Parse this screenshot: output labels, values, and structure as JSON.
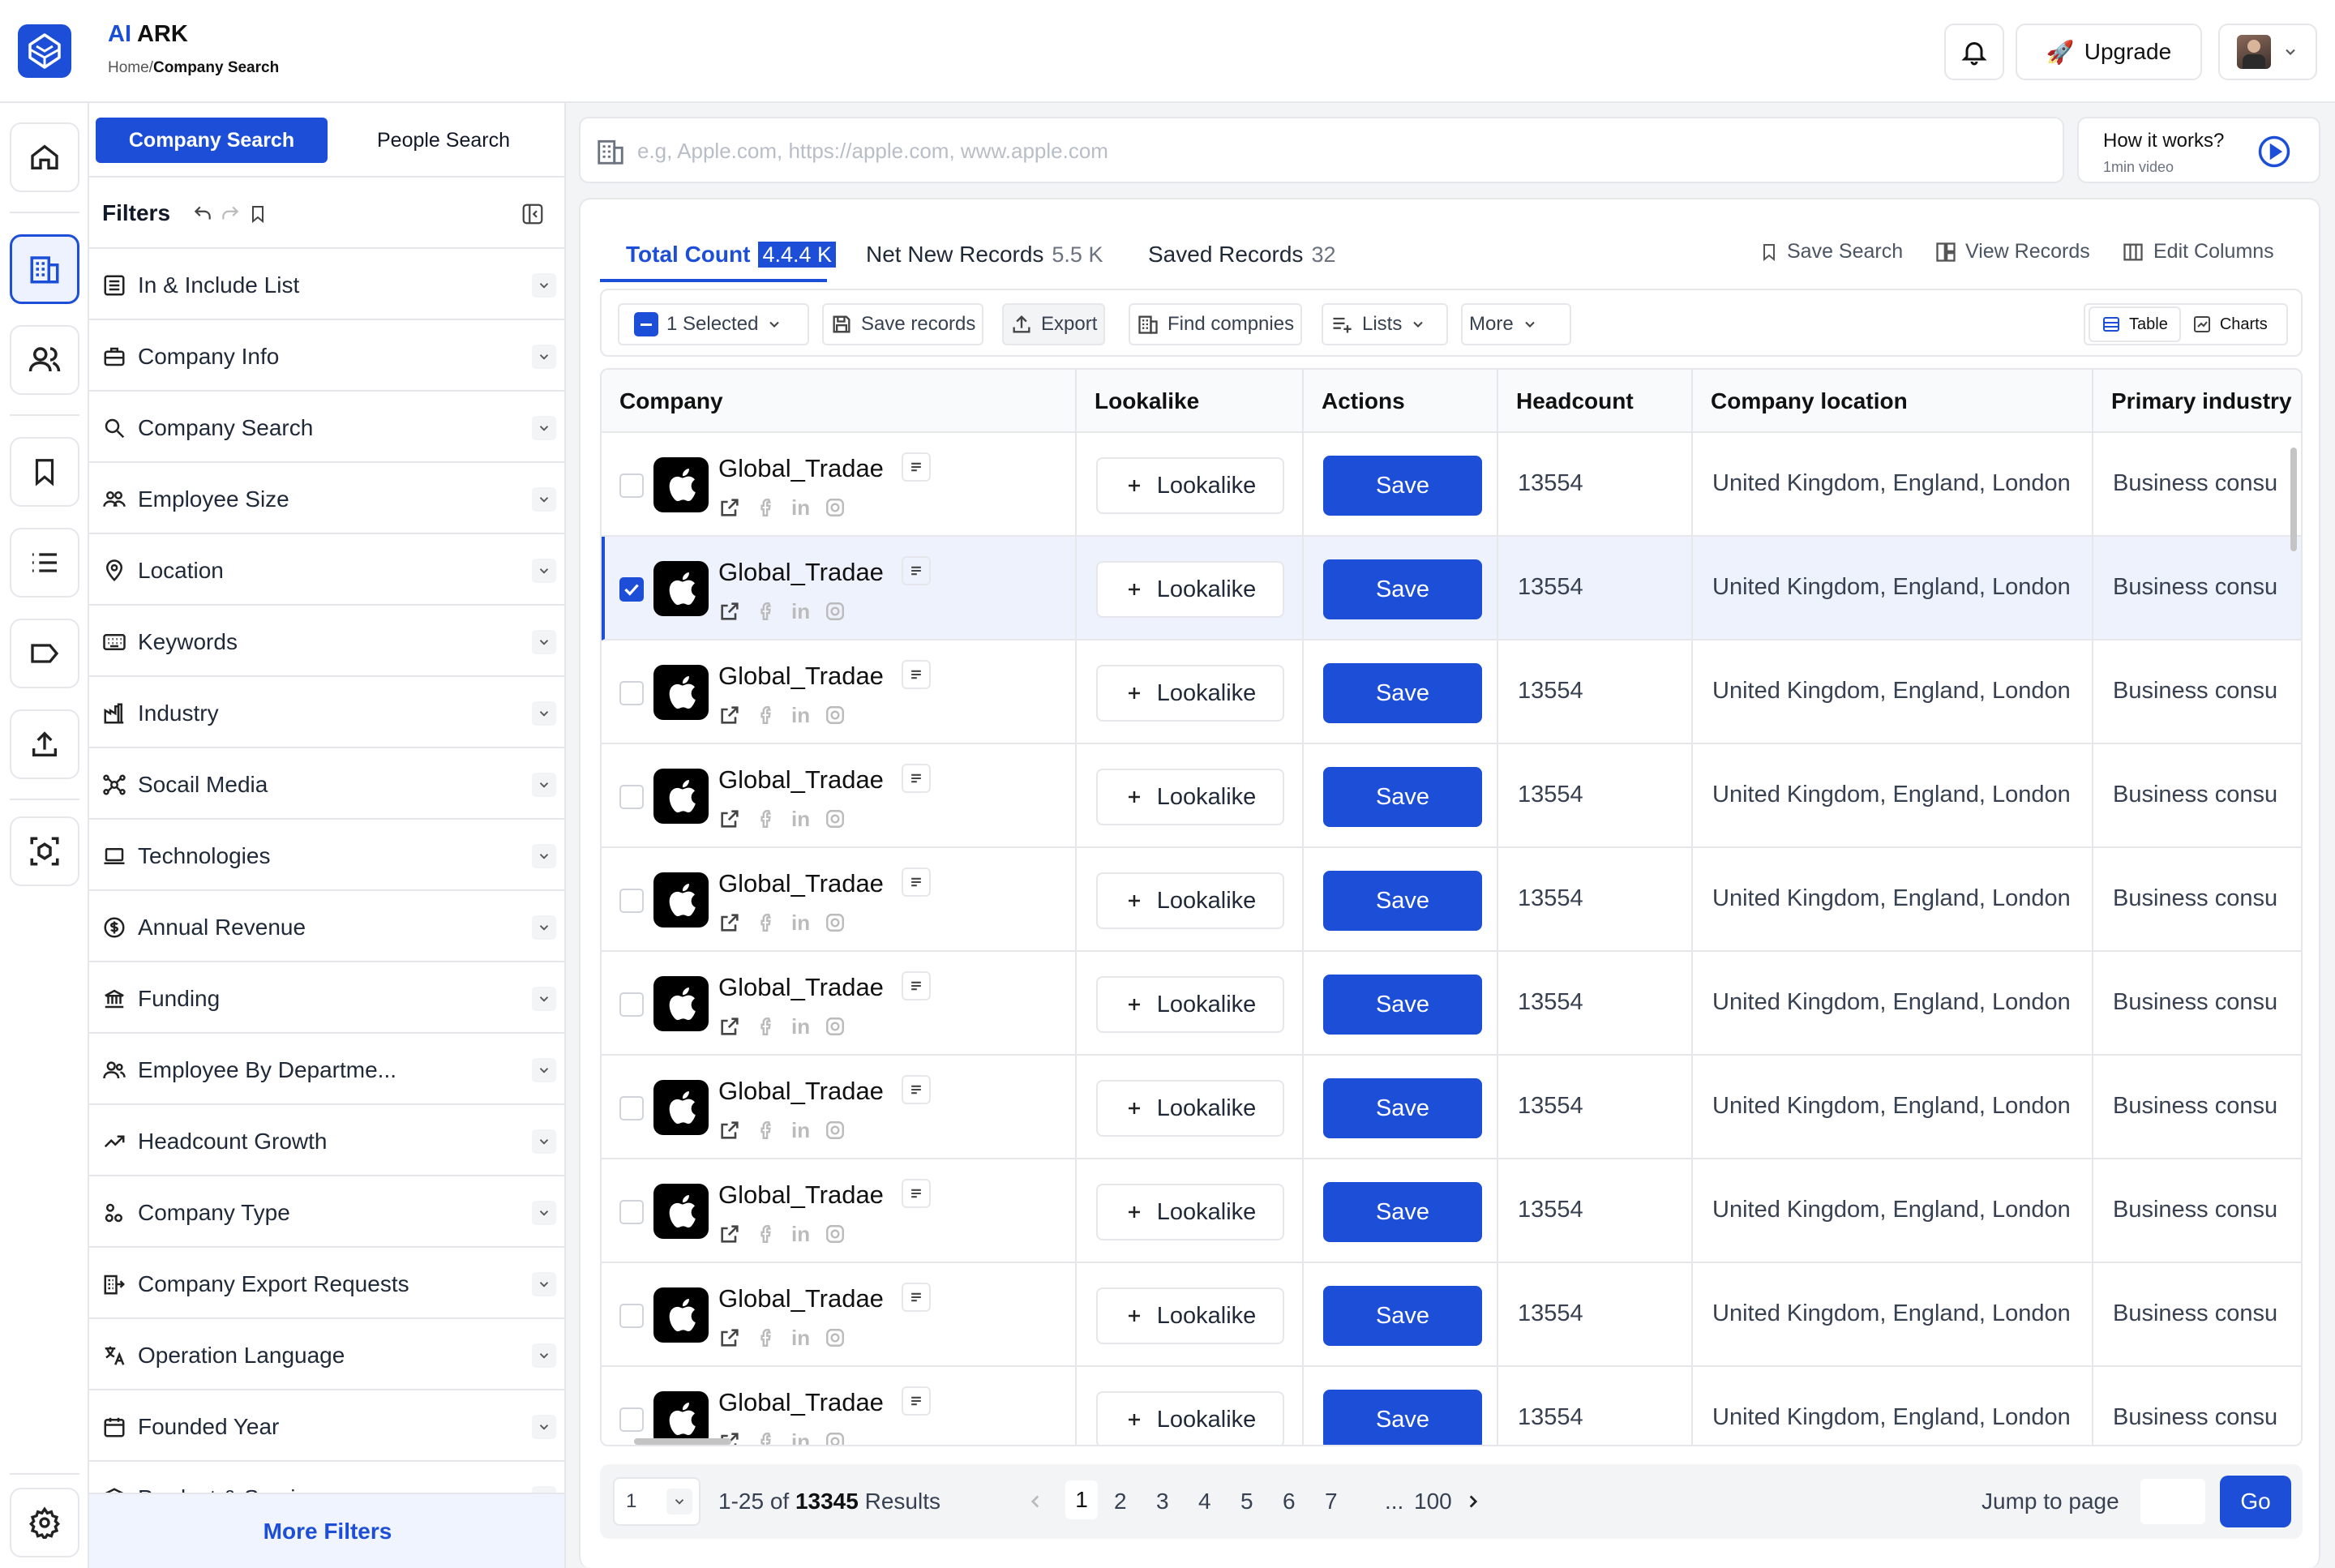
{
  "header": {
    "brand_ai": "AI",
    "brand_rest": " ARK",
    "breadcrumb_home": "Home/",
    "breadcrumb_current": "Company Search",
    "upgrade_label": "Upgrade",
    "upgrade_emoji": "🚀"
  },
  "filters": {
    "tab_company": "Company Search",
    "tab_people": "People Search",
    "title": "Filters",
    "items": [
      {
        "label": "In & Include List",
        "icon": "list-icon"
      },
      {
        "label": "Company Info",
        "icon": "briefcase-icon"
      },
      {
        "label": "Company Search",
        "icon": "search-icon"
      },
      {
        "label": "Employee Size",
        "icon": "people-icon"
      },
      {
        "label": "Location",
        "icon": "pin-icon"
      },
      {
        "label": "Keywords",
        "icon": "keyboard-icon"
      },
      {
        "label": "Industry",
        "icon": "factory-icon"
      },
      {
        "label": "Socail Media",
        "icon": "network-icon"
      },
      {
        "label": "Technologies",
        "icon": "laptop-icon"
      },
      {
        "label": "Annual Revenue",
        "icon": "dollar-icon"
      },
      {
        "label": "Funding",
        "icon": "bank-icon"
      },
      {
        "label": "Employee By Departme...",
        "icon": "team-icon"
      },
      {
        "label": "Headcount Growth",
        "icon": "trend-icon"
      },
      {
        "label": "Company Type",
        "icon": "shapes-icon"
      },
      {
        "label": "Company Export Requests",
        "icon": "building-export-icon"
      },
      {
        "label": "Operation Language",
        "icon": "translate-icon"
      },
      {
        "label": "Founded Year",
        "icon": "calendar-icon"
      },
      {
        "label": "Product & Services",
        "icon": "box-icon"
      }
    ],
    "more_filters": "More Filters"
  },
  "search": {
    "placeholder": "e.g, Apple.com, https://apple.com, www.apple.com",
    "value": ""
  },
  "howto": {
    "title": "How it works?",
    "subtitle": "1min video"
  },
  "results_tabs": [
    {
      "label": "Total Count",
      "count": "4.4.4 K"
    },
    {
      "label": "Net New Records",
      "count": "5.5 K"
    },
    {
      "label": "Saved Records",
      "count": "32"
    }
  ],
  "right_actions": {
    "save_search": "Save Search",
    "view_records": "View Records",
    "edit_columns": "Edit Columns"
  },
  "toolbar": {
    "selected": "1 Selected",
    "save_records": "Save records",
    "export": "Export",
    "find": "Find compnies",
    "lists": "Lists",
    "more": "More",
    "table": "Table",
    "charts": "Charts"
  },
  "table": {
    "headers": [
      "Company",
      "Lookalike",
      "Actions",
      "Headcount",
      "Company location",
      "Primary industry"
    ],
    "lookalike_label": "Lookalike",
    "save_label": "Save",
    "rows": [
      {
        "name": "Global_Tradae",
        "headcount": "13554",
        "location": "United Kingdom, England, London",
        "industry": "Business consulting",
        "checked": false
      },
      {
        "name": "Global_Tradae",
        "headcount": "13554",
        "location": "United Kingdom, England, London",
        "industry": "Business consulting",
        "checked": true
      },
      {
        "name": "Global_Tradae",
        "headcount": "13554",
        "location": "United Kingdom, England, London",
        "industry": "Business consulting",
        "checked": false
      },
      {
        "name": "Global_Tradae",
        "headcount": "13554",
        "location": "United Kingdom, England, London",
        "industry": "Business consulting",
        "checked": false
      },
      {
        "name": "Global_Tradae",
        "headcount": "13554",
        "location": "United Kingdom, England, London",
        "industry": "Business consulting",
        "checked": false
      },
      {
        "name": "Global_Tradae",
        "headcount": "13554",
        "location": "United Kingdom, England, London",
        "industry": "Business consulting",
        "checked": false
      },
      {
        "name": "Global_Tradae",
        "headcount": "13554",
        "location": "United Kingdom, England, London",
        "industry": "Business consulting",
        "checked": false
      },
      {
        "name": "Global_Tradae",
        "headcount": "13554",
        "location": "United Kingdom, England, London",
        "industry": "Business consulting",
        "checked": false
      },
      {
        "name": "Global_Tradae",
        "headcount": "13554",
        "location": "United Kingdom, England, London",
        "industry": "Business consulting",
        "checked": false
      },
      {
        "name": "Global_Tradae",
        "headcount": "13554",
        "location": "United Kingdom, England, London",
        "industry": "Business consulting",
        "checked": false
      }
    ]
  },
  "pagination": {
    "page_size": "1",
    "range": "1-25 of",
    "total": "13345",
    "results_word": "Results",
    "pages": [
      "1",
      "2",
      "3",
      "4",
      "5",
      "6",
      "7"
    ],
    "ellipsis": "...",
    "last_page": "100",
    "jump_label": "Jump to page",
    "jump_value": "",
    "go": "Go"
  },
  "colors": {
    "primary": "#1d4ed8",
    "border": "#e5e7eb",
    "bg": "#f3f4f6"
  }
}
